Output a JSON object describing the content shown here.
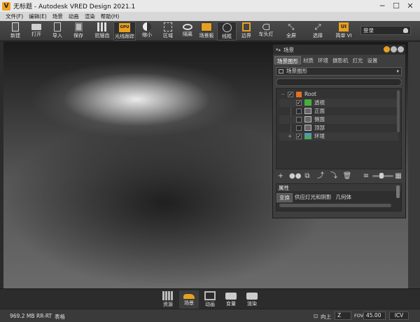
{
  "window": {
    "title": "无标题 - Autodesk VRED Design 2021.1",
    "logo": "V",
    "controls": [
      "minimize-icon",
      "maximize-icon",
      "close-icon"
    ]
  },
  "menu": [
    "文件(F)",
    "编辑(E)",
    "场景",
    "动画",
    "渲染",
    "帮助(H)"
  ],
  "toolbar": {
    "buttons": [
      {
        "label": "新建",
        "icon": "new-file-icon"
      },
      {
        "label": "打开",
        "icon": "folder-icon"
      },
      {
        "label": "导入",
        "icon": "import-icon"
      },
      {
        "label": "保存",
        "icon": "save-icon"
      },
      {
        "label": "抗锯齿",
        "icon": "antialias-icon"
      },
      {
        "label": "光线跟踪",
        "icon": "gpu-icon",
        "badge": "GPU"
      },
      {
        "label": "缩小",
        "icon": "half-circle-icon"
      },
      {
        "label": "区域",
        "icon": "region-icon"
      },
      {
        "label": "隔离",
        "icon": "eye-icon"
      },
      {
        "label": "场景板",
        "icon": "sceneplate-icon"
      },
      {
        "label": "线框",
        "icon": "wireframe-icon"
      },
      {
        "label": "边界",
        "icon": "bounds-icon"
      },
      {
        "label": "车头灯",
        "icon": "headlight-icon"
      },
      {
        "label": "全屏",
        "icon": "fullscreen-icon"
      },
      {
        "label": "选择",
        "icon": "select-icon"
      },
      {
        "label": "简单 VI",
        "icon": "ui-icon",
        "badge": "UI"
      }
    ],
    "login": "登录"
  },
  "scene_panel": {
    "title": "场景",
    "tabs": [
      "场景图形",
      "材质",
      "环境",
      "摄影机",
      "灯光",
      "设置"
    ],
    "active_tab": "场景图形",
    "dropdown": "场景图形",
    "tree": [
      {
        "label": "Root",
        "icon": "group-icon"
      },
      {
        "label": "透视",
        "icon": "camera-icon"
      },
      {
        "label": "正面",
        "icon": "camera-icon"
      },
      {
        "label": "侧面",
        "icon": "camera-icon"
      },
      {
        "label": "顶部",
        "icon": "camera-icon"
      },
      {
        "label": "环境",
        "icon": "environment-icon"
      }
    ],
    "properties": {
      "title": "属性",
      "tabs": [
        "变换",
        "供应灯光和阴影",
        "几何体"
      ],
      "active_tab": "变换"
    }
  },
  "modules": [
    {
      "label": "资源",
      "icon": "books-icon"
    },
    {
      "label": "场景",
      "icon": "car-icon"
    },
    {
      "label": "动画",
      "icon": "film-icon"
    },
    {
      "label": "变量",
      "icon": "variant-icon"
    },
    {
      "label": "渲染",
      "icon": "camera-icon"
    }
  ],
  "status": {
    "memory": "969.2 MB",
    "mode": "RR-RT",
    "extra": "表格",
    "view": "向上",
    "axis": "Z",
    "fov_label": "FOV",
    "fov": "45.00",
    "color_mode": "ICV"
  }
}
